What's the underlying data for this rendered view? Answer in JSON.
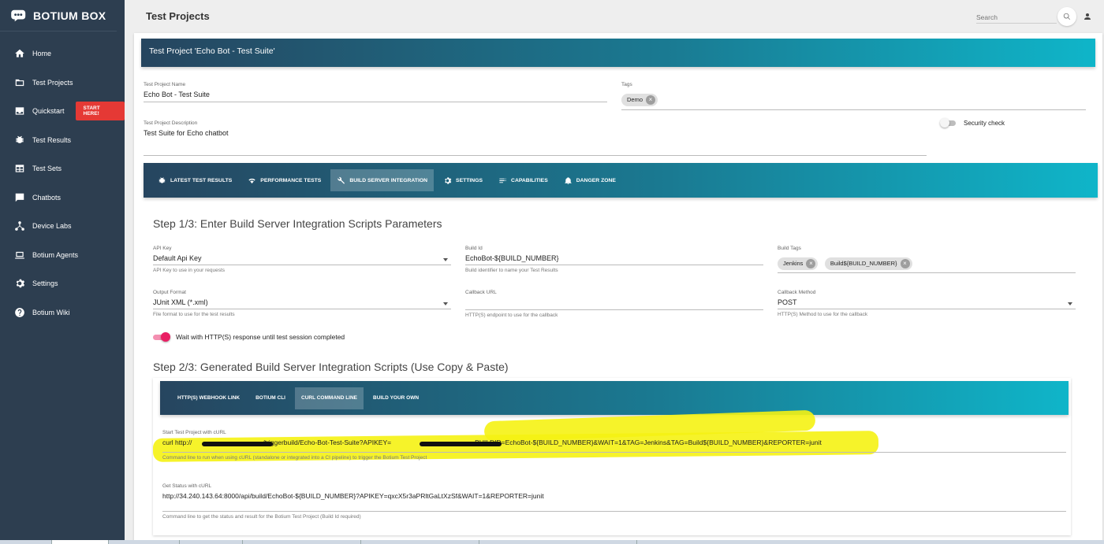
{
  "sidebar": {
    "brand": "BOTIUM BOX",
    "items": [
      {
        "label": "Home",
        "icon": "home-icon"
      },
      {
        "label": "Test Projects",
        "icon": "folder-icon"
      },
      {
        "label": "Quickstart",
        "icon": "inbox-icon",
        "badge": "START HERE!"
      },
      {
        "label": "Test Results",
        "icon": "bug-icon"
      },
      {
        "label": "Test Sets",
        "icon": "table-icon"
      },
      {
        "label": "Chatbots",
        "icon": "chat-icon"
      },
      {
        "label": "Device Labs",
        "icon": "network-icon"
      },
      {
        "label": "Botium Agents",
        "icon": "laptop-icon"
      },
      {
        "label": "Settings",
        "icon": "gear-icon"
      },
      {
        "label": "Botium Wiki",
        "icon": "help-icon"
      }
    ]
  },
  "topbar": {
    "title": "Test Projects",
    "search_placeholder": "Search"
  },
  "card": {
    "header": "Test Project 'Echo Bot - Test Suite'",
    "name_label": "Test Project Name",
    "name_value": "Echo Bot - Test Suite",
    "tags_label": "Tags",
    "tags": [
      "Demo"
    ],
    "desc_label": "Test Project Description",
    "desc_value": "Test Suite for Echo chatbot",
    "security_label": "Security check"
  },
  "tabs": [
    {
      "label": "LATEST TEST RESULTS",
      "icon": "bug-icon"
    },
    {
      "label": "PERFORMANCE TESTS",
      "icon": "wifi-icon"
    },
    {
      "label": "BUILD SERVER INTEGRATION",
      "icon": "wrench-icon",
      "active": true
    },
    {
      "label": "SETTINGS",
      "icon": "gear-icon"
    },
    {
      "label": "CAPABILITIES",
      "icon": "list-icon"
    },
    {
      "label": "DANGER ZONE",
      "icon": "bell-icon"
    }
  ],
  "step1": {
    "title": "Step 1/3: Enter Build Server Integration Scripts Parameters",
    "api_key_label": "API Key",
    "api_key_value": "Default Api Key",
    "api_key_hint": "API Key to use in your requests",
    "build_id_label": "Build Id",
    "build_id_value": "EchoBot-${BUILD_NUMBER}",
    "build_id_hint": "Build identifier to name your Test Results",
    "build_tags_label": "Build Tags",
    "build_tags": [
      "Jenkins",
      "Build${BUILD_NUMBER}"
    ],
    "output_label": "Output Format",
    "output_value": "JUnit XML (*.xml)",
    "output_hint": "File format to use for the test results",
    "callback_url_label": "Callback URL",
    "callback_url_hint": "HTTP(S) endpoint to use for the callback",
    "callback_method_label": "Callback Method",
    "callback_method_value": "POST",
    "callback_method_hint": "HTTP(S) Method to use for the callback",
    "wait_label": "Wait with HTTP(S) response until test session completed"
  },
  "step2": {
    "title": "Step 2/3: Generated Build Server Integration Scripts (Use Copy & Paste)",
    "tabs": [
      {
        "label": "HTTP(S) WEBHOOK LINK"
      },
      {
        "label": "BOTIUM CLI"
      },
      {
        "label": "CURL COMMAND LINE",
        "active": true
      },
      {
        "label": "BUILD YOUR OWN"
      }
    ],
    "start_label": "Start Test Project with cURL",
    "start_cmd_a": "curl http://",
    "start_cmd_b": "/triggerbuild/Echo-Bot-Test-Suite?APIKEY=",
    "start_cmd_c": "BUILDID=EchoBot-${BUILD_NUMBER}&WAIT=1&TAG=Jenkins&TAG=Build${BUILD_NUMBER}&REPORTER=junit",
    "start_hint": "Command line to run when using cURL (standalone or integrated into a CI pipeline) to trigger the Botium Test Project",
    "status_label": "Get Status with cURL",
    "status_cmd": "http://34.240.143.64:8000/api/build/EchoBot-${BUILD_NUMBER}?APIKEY=qxcX5r3aPRltGaLtXzSf&WAIT=1&REPORTER=junit",
    "status_hint": "Command line to get the status and result for the Botium Test Project (Build Id required)"
  },
  "colors": {
    "sidebar": "#2d3e50",
    "accent_start": "#26455f",
    "accent_end": "#0fb5c9",
    "toggle_on": "#e91e63",
    "start_here": "#e53935",
    "highlight": "#f5f213"
  }
}
